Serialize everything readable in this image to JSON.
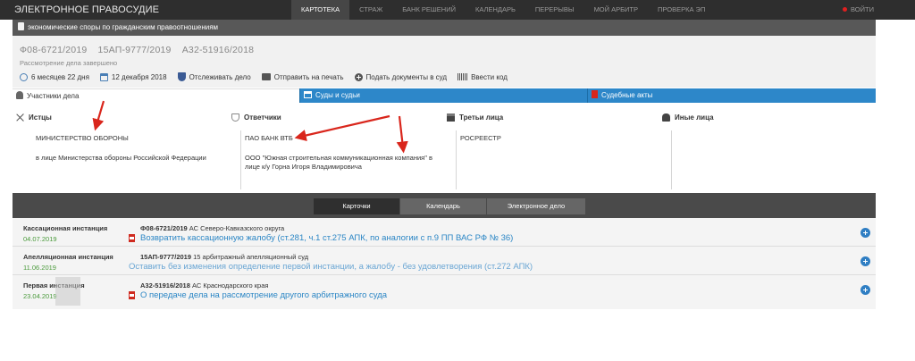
{
  "app": {
    "title": "ЭЛЕКТРОННОЕ ПРАВОСУДИЕ",
    "nav": [
      "КАРТОТЕКА",
      "СТРАЖ",
      "БАНК РЕШЕНИЙ",
      "КАЛЕНДАРЬ",
      "ПЕРЕРЫВЫ",
      "МОЙ АРБИТР",
      "ПРОВЕРКА ЭП"
    ],
    "active_nav": "КАРТОТЕКА",
    "logout": "ВОЙТИ"
  },
  "category": "экономические споры по гражданским правоотношениям",
  "case": {
    "numbers": [
      "Ф08-6721/2019",
      "15АП-9777/2019",
      "А32-51916/2018"
    ],
    "status": "Рассмотрение дела завершено",
    "duration": "6 месяцев 22 дня",
    "date": "12 декабря 2018",
    "actions": {
      "track": "Отслеживать дело",
      "print": "Отправить на печать",
      "submit": "Подать документы в суд",
      "code": "Ввести код"
    }
  },
  "tabs": [
    "Участники дела",
    "Суды и судьи",
    "Судебные акты"
  ],
  "participants": {
    "plaintiffs": {
      "title": "Истцы",
      "name": "МИНИСТЕРСТВО ОБОРОНЫ",
      "sub": "в лице Министерства обороны Российской Федерации"
    },
    "defendants": {
      "title": "Ответчики",
      "name": "ПАО БАНК ВТБ",
      "sub": "ООО \"Южная строительная коммуникационная компания\" в лице к/у Горна Игоря Владимировича"
    },
    "third": {
      "title": "Третьи лица",
      "name": "РОСРЕЕСТР"
    },
    "other": {
      "title": "Иные лица"
    }
  },
  "lower": {
    "tabs": [
      "Карточки",
      "Календарь",
      "Электронное дело"
    ],
    "active_tab": "Карточки",
    "instances": [
      {
        "level": "Кассационная инстанция",
        "date": "04.07.2019",
        "case_no": "Ф08-6721/2019",
        "court": "АС Северо-Кавказского округа",
        "act": "Возвратить кассационную жалобу (ст.281, ч.1 ст.275 АПК, по аналогии с п.9 ПП ВАС РФ № 36)"
      },
      {
        "level": "Апелляционная инстанция",
        "date": "11.06.2019",
        "case_no": "15АП-9777/2019",
        "court": "15 арбитражный апелляционный суд",
        "act": "Оставить без изменения определение первой инстанции, а жалобу - без удовлетворения (ст.272 АПК)"
      },
      {
        "level": "Первая инстанция",
        "date": "23.04.2019",
        "case_no": "А32-51916/2018",
        "court": "АС Краснодарского края",
        "act": "О передаче дела на рассмотрение другого арбитражного суда"
      }
    ]
  },
  "colors": {
    "topbar": "#2e2e2e",
    "accent_blue": "#2d87c9",
    "link_blue": "#2b86c5",
    "date_green": "#4a9a3b",
    "arrow_red": "#d9261c"
  }
}
